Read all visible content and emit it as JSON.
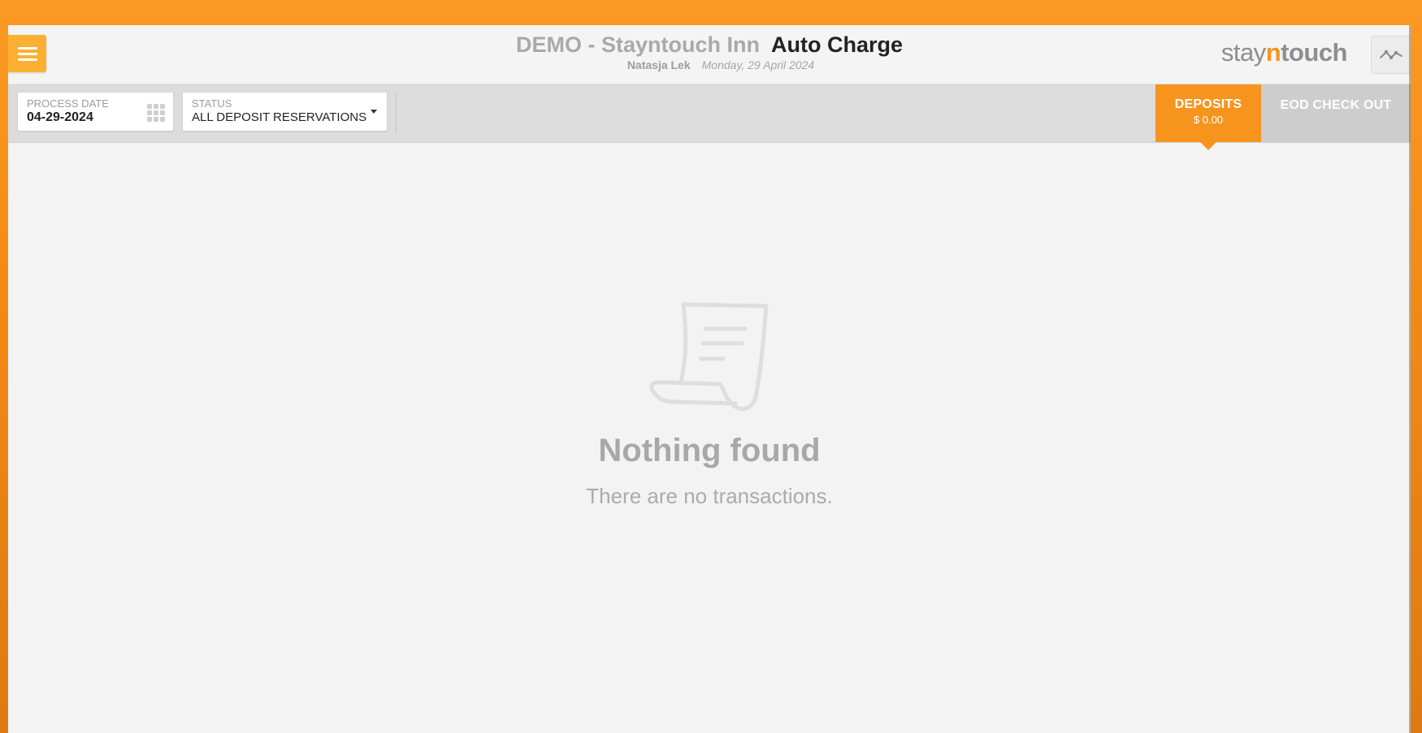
{
  "header": {
    "hotel_name": "DEMO - Stayntouch Inn",
    "page_title": "Auto Charge",
    "user_name": "Natasja Lek",
    "business_date": "Monday, 29 April 2024",
    "brand": {
      "part1": "stay",
      "part2": "n",
      "part3": "touch"
    },
    "menu_icon": "hamburger-icon",
    "activity_icon": "activity-line-icon"
  },
  "filters": {
    "process_date": {
      "label": "PROCESS DATE",
      "value": "04-29-2024",
      "icon": "calendar-grid-icon"
    },
    "status": {
      "label": "STATUS",
      "value": "ALL DEPOSIT RESERVATIONS",
      "icon": "caret-down-icon"
    }
  },
  "tabs": [
    {
      "label": "DEPOSITS",
      "amount": "$ 0.00",
      "active": true
    },
    {
      "label": "EOD CHECK OUT",
      "active": false
    }
  ],
  "empty_state": {
    "icon": "receipt-icon",
    "title": "Nothing found",
    "message": "There are no transactions."
  },
  "colors": {
    "accent": "#f7941e",
    "menu_button": "#fbb034",
    "frame": "#fb9a24"
  }
}
